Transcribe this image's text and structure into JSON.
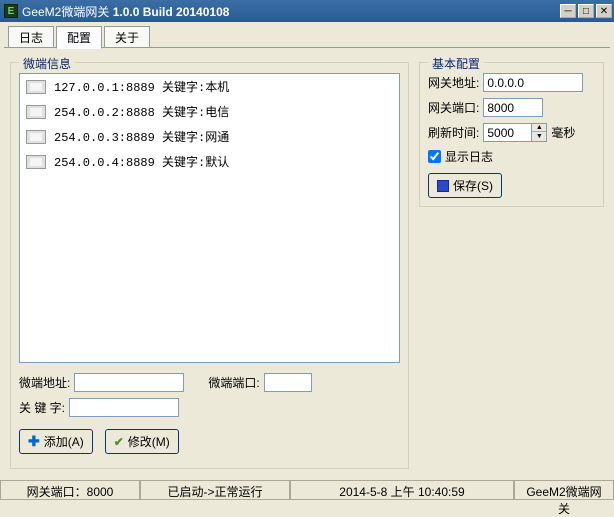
{
  "window": {
    "icon_letter": "E",
    "title_prefix": "GeeM2微端网关 ",
    "title_version": "1.0.0 Build 20140108"
  },
  "tabs": [
    "日志",
    "配置",
    "关于"
  ],
  "active_tab": 1,
  "micro_info": {
    "title": "微端信息",
    "items": [
      "127.0.0.1:8889 关键字:本机",
      "254.0.0.2:8888 关键字:电信",
      "254.0.0.3:8889 关键字:网通",
      "254.0.0.4:8889 关键字:默认"
    ],
    "addr_label": "微端地址:",
    "port_label": "微端端口:",
    "keyword_label": "关 键 字:",
    "add_btn": "添加(A)",
    "modify_btn": "修改(M)"
  },
  "basic": {
    "title": "基本配置",
    "gateway_addr_label": "网关地址:",
    "gateway_addr_value": "0.0.0.0",
    "gateway_port_label": "网关端口:",
    "gateway_port_value": "8000",
    "refresh_label": "刷新时间:",
    "refresh_value": "5000",
    "refresh_unit": "毫秒",
    "show_log_label": "显示日志",
    "show_log_checked": true,
    "save_btn": "保存(S)"
  },
  "status": {
    "port": "网关端口：8000",
    "state": "已启动->正常运行",
    "time": "2014-5-8 上午 10:40:59",
    "app": "GeeM2微端网关"
  }
}
